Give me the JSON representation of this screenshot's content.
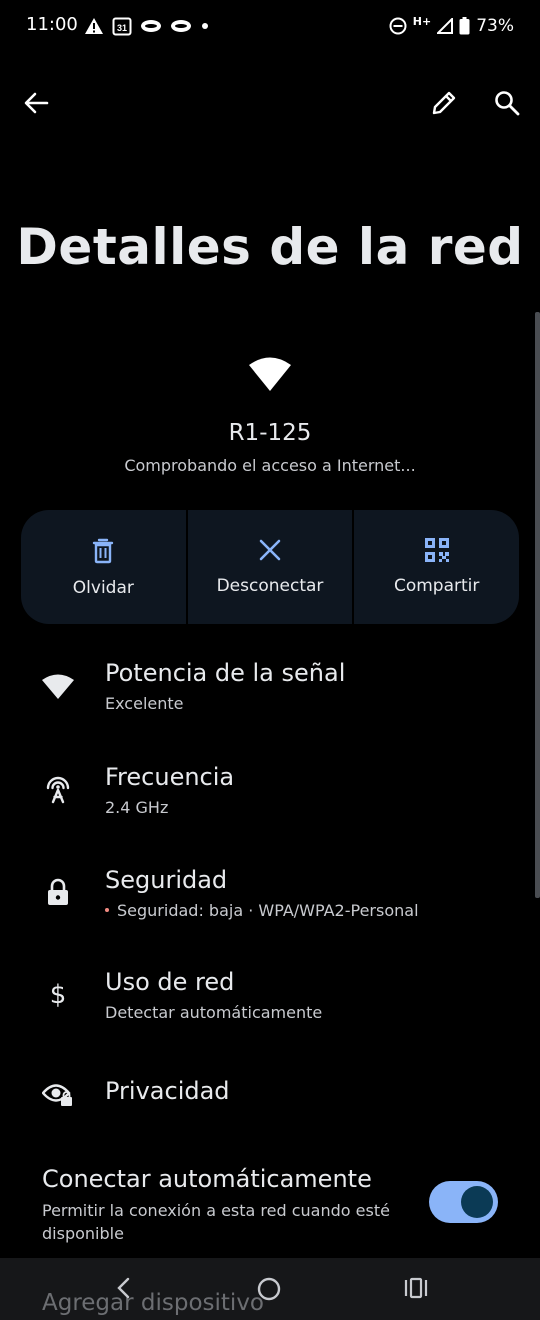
{
  "status_bar": {
    "time": "11:00",
    "network_label": "H+",
    "battery": "73%",
    "icons_left": [
      "warning-icon",
      "calendar-icon",
      "eye-icon",
      "eye-icon",
      "dot-icon"
    ],
    "calendar_day": "31"
  },
  "top_bar": {
    "back_icon": "arrow-left-icon",
    "edit_icon": "pencil-icon",
    "search_icon": "search-icon"
  },
  "page_title": "Detalles de la red",
  "network": {
    "name": "R1-125",
    "status": "Comprobando el acceso a Internet..."
  },
  "actions": [
    {
      "label": "Olvidar",
      "icon": "trash-icon"
    },
    {
      "label": "Desconectar",
      "icon": "close-icon"
    },
    {
      "label": "Compartir",
      "icon": "qr-code-icon"
    }
  ],
  "details": {
    "signal": {
      "title": "Potencia de la señal",
      "value": "Excelente",
      "icon": "wifi-icon"
    },
    "frequency": {
      "title": "Frecuencia",
      "value": "2.4 GHz",
      "icon": "antenna-icon"
    },
    "security": {
      "title": "Seguridad",
      "value": "Seguridad: baja · WPA/WPA2-Personal",
      "icon": "lock-icon",
      "alert_color": "#f28b82"
    },
    "data_usage": {
      "title": "Uso de red",
      "value": "Detectar automáticamente",
      "icon": "dollar-icon"
    },
    "privacy": {
      "title": "Privacidad",
      "icon": "eye-lock-icon"
    }
  },
  "auto_connect": {
    "title": "Conectar automáticamente",
    "description": "Permitir la conexión a esta red cuando esté disponible",
    "enabled": true,
    "accent": "#8ab4f8"
  },
  "next_item_label": "Agregar dispositivo",
  "nav_bar": {
    "back": "chevron-left-icon",
    "home": "home-circle-icon",
    "recents": "recents-icon"
  }
}
